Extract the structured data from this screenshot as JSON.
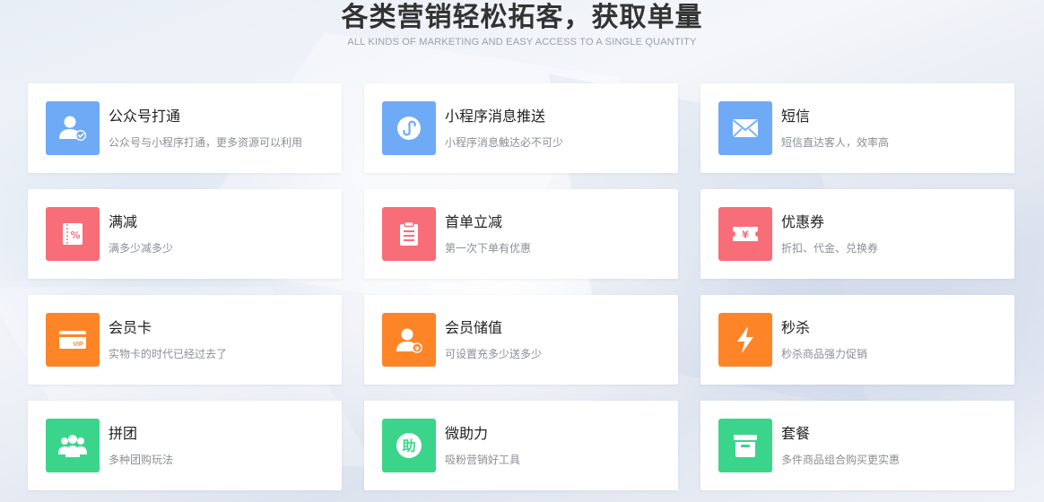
{
  "header": {
    "title": "各类营销轻松拓客，获取单量",
    "subtitle": "ALL KINDS OF MARKETING AND EASY ACCESS TO A SINGLE QUANTITY"
  },
  "colors": {
    "blue": "#6eaaf6",
    "red": "#f76d78",
    "orange": "#fd8528",
    "green": "#3ad58a"
  },
  "cards": [
    {
      "title": "公众号打通",
      "desc": "公众号与小程序打通，更多资源可以利用",
      "icon": "user-check-icon",
      "color": "#6eaaf6"
    },
    {
      "title": "小程序消息推送",
      "desc": "小程序消息触达必不可少",
      "icon": "mini-program-icon",
      "color": "#6eaaf6"
    },
    {
      "title": "短信",
      "desc": "短信直达客人，效率高",
      "icon": "envelope-icon",
      "color": "#6eaaf6"
    },
    {
      "title": "满减",
      "desc": "满多少减多少",
      "icon": "percent-ticket-icon",
      "color": "#f76d78"
    },
    {
      "title": "首单立减",
      "desc": "第一次下单有优惠",
      "icon": "clipboard-icon",
      "color": "#f76d78"
    },
    {
      "title": "优惠券",
      "desc": "折扣、代金、兑换券",
      "icon": "yen-coupon-icon",
      "color": "#f76d78"
    },
    {
      "title": "会员卡",
      "desc": "实物卡的时代已经过去了",
      "icon": "vip-card-icon",
      "color": "#fd8528"
    },
    {
      "title": "会员储值",
      "desc": "可设置充多少送多少",
      "icon": "member-value-icon",
      "color": "#fd8528"
    },
    {
      "title": "秒杀",
      "desc": "秒杀商品强力促销",
      "icon": "lightning-icon",
      "color": "#fd8528"
    },
    {
      "title": "拼团",
      "desc": "多种团购玩法",
      "icon": "group-icon",
      "color": "#3ad58a"
    },
    {
      "title": "微助力",
      "desc": "吸粉营销好工具",
      "icon": "assist-badge-icon",
      "color": "#3ad58a"
    },
    {
      "title": "套餐",
      "desc": "多件商品组合购买更实惠",
      "icon": "package-box-icon",
      "color": "#3ad58a"
    }
  ]
}
